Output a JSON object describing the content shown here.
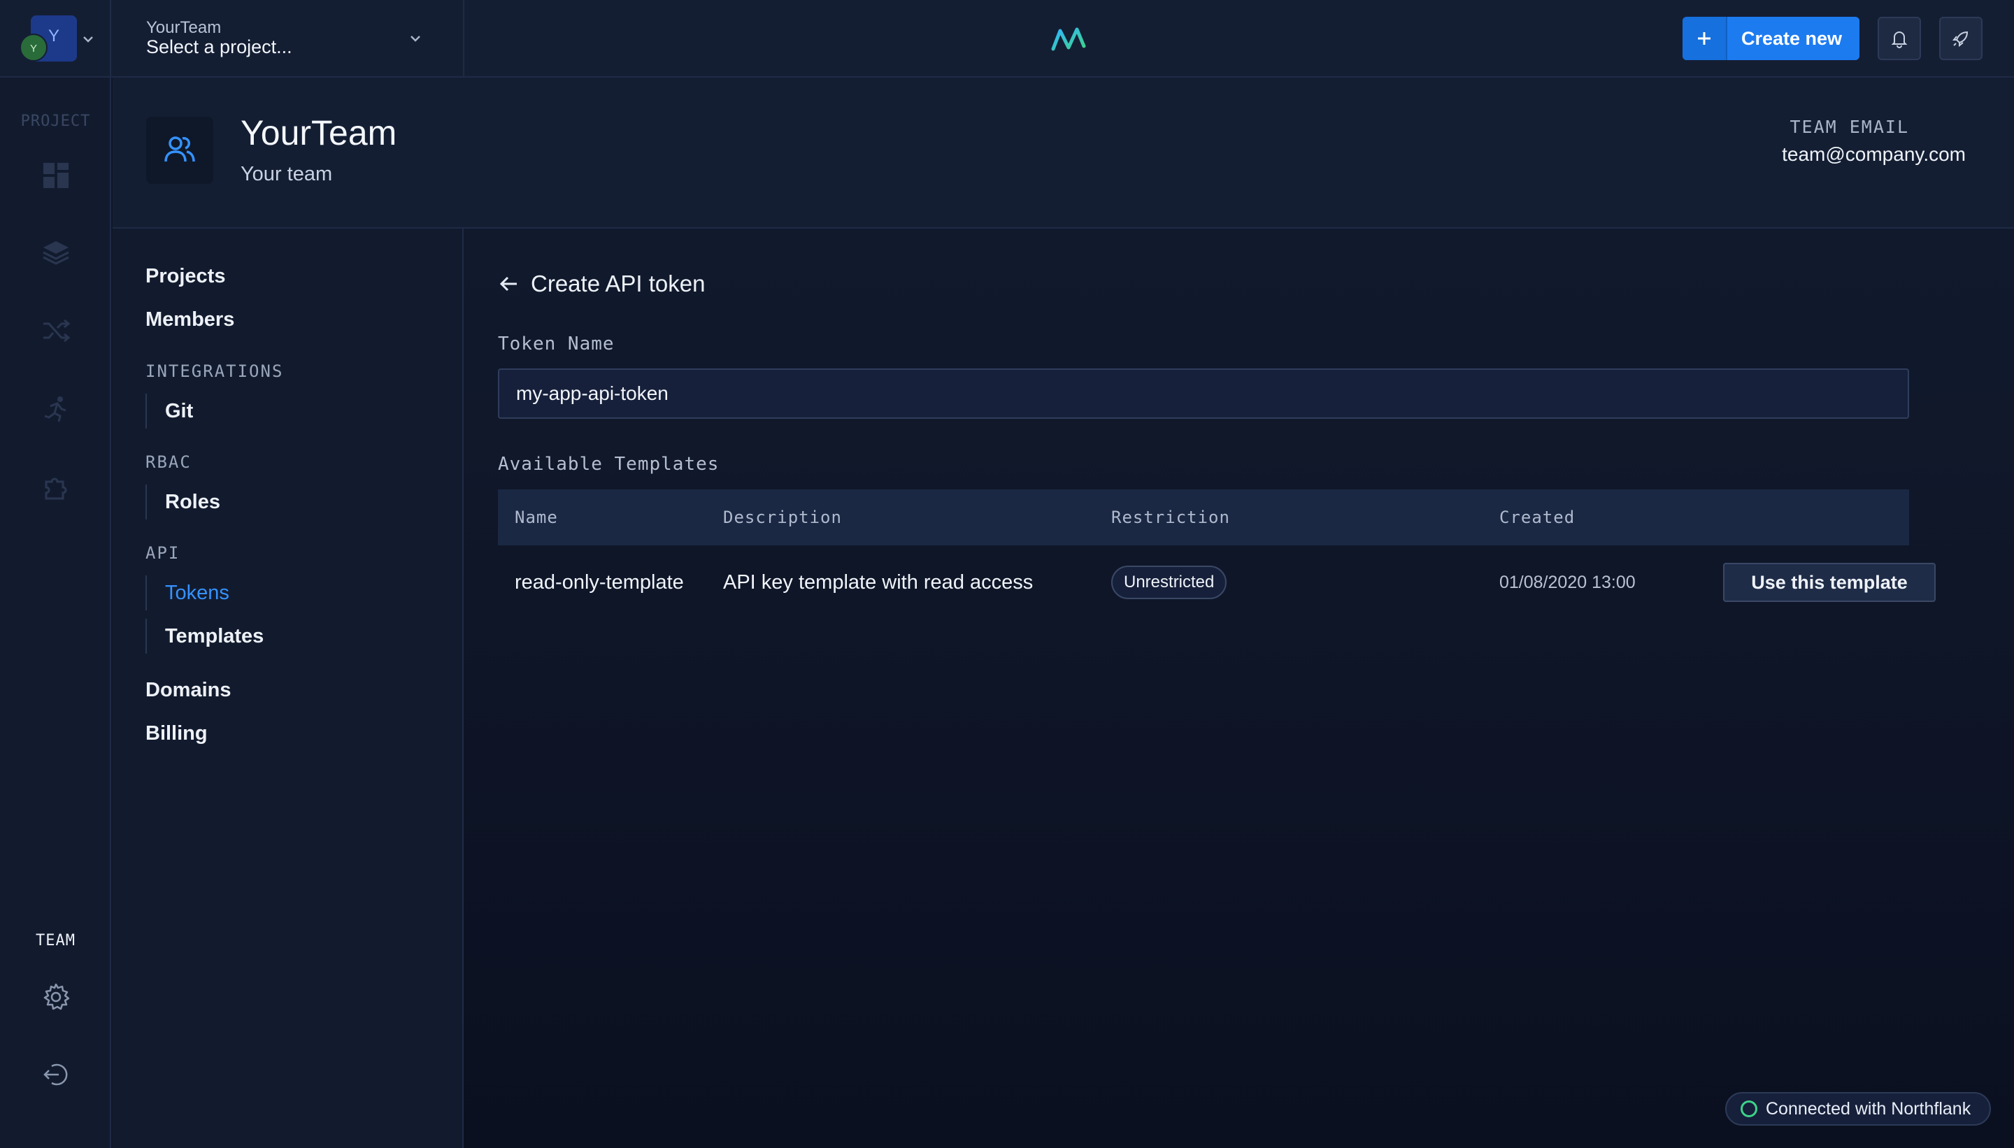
{
  "topbar": {
    "team_avatar_letter": "Y",
    "user_avatar_letter": "Y",
    "project_team": "YourTeam",
    "project_placeholder": "Select a project...",
    "create_label": "Create new",
    "brand_color": "#1d7bf0"
  },
  "rail": {
    "project_label": "PROJECT",
    "team_label": "TEAM",
    "icons": [
      "dashboard-icon",
      "layers-icon",
      "shuffle-icon",
      "runner-icon",
      "puzzle-icon",
      "gear-icon",
      "logout-icon"
    ]
  },
  "team_header": {
    "name": "YourTeam",
    "description": "Your team",
    "email_label": "TEAM EMAIL",
    "email": "team@company.com"
  },
  "subnav": {
    "projects": "Projects",
    "members": "Members",
    "integrations_label": "INTEGRATIONS",
    "git": "Git",
    "rbac_label": "RBAC",
    "roles": "Roles",
    "api_label": "API",
    "tokens": "Tokens",
    "templates": "Templates",
    "domains": "Domains",
    "billing": "Billing",
    "active_color": "#3592ff"
  },
  "main": {
    "title": "Create API token",
    "token_name_label": "Token Name",
    "token_name_value": "my-app-api-token",
    "templates_label": "Available Templates",
    "table": {
      "headers": [
        "Name",
        "Description",
        "Restriction",
        "Created"
      ],
      "rows": [
        {
          "name": "read-only-template",
          "description": "API key template with read access",
          "restriction": "Unrestricted",
          "created": "01/08/2020 13:00",
          "action": "Use this template"
        }
      ]
    }
  },
  "status": {
    "text": "Connected with Northflank",
    "color": "#3ed28a"
  }
}
